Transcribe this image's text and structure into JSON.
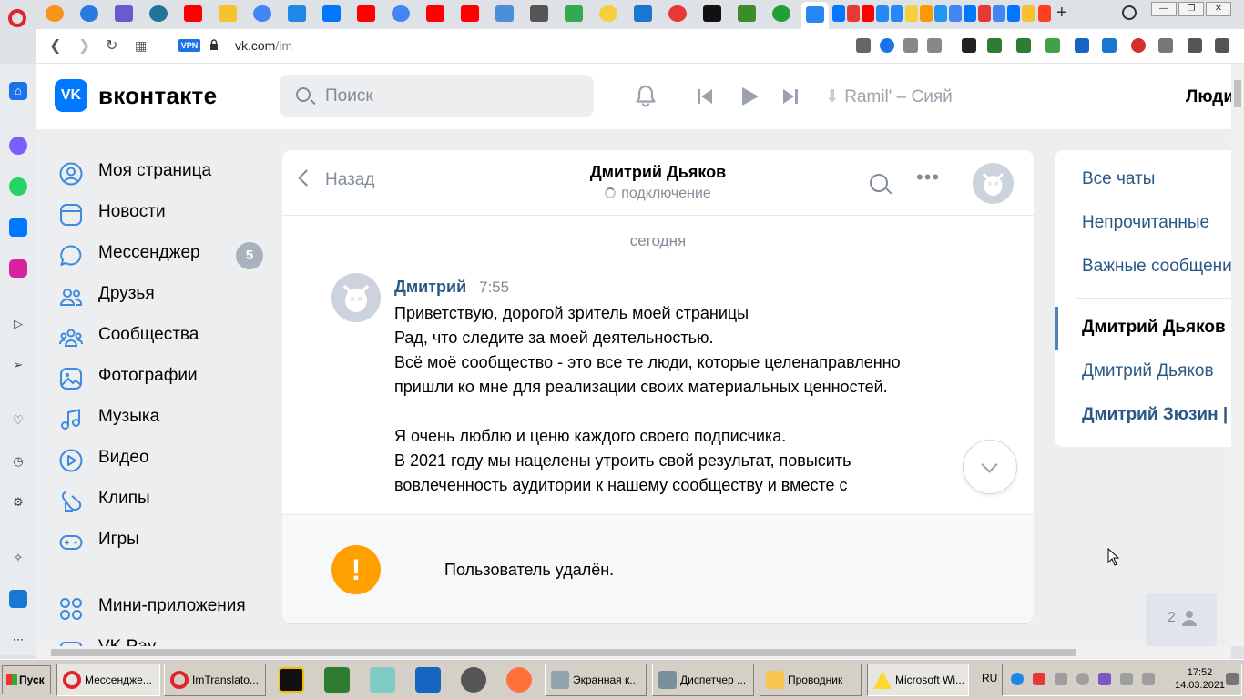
{
  "browser": {
    "url_host": "vk.com",
    "url_path": "/im",
    "vpn_label": "VPN",
    "newtab_glyph": "+",
    "window_buttons": [
      "—",
      "❐",
      "✕"
    ]
  },
  "vk": {
    "logo_mark": "VK",
    "logo_text": "вконтакте",
    "search_placeholder": "Поиск",
    "player_track": "Ramil' – Сияй",
    "people_link": "Люди",
    "menu": [
      {
        "label": "Моя страница"
      },
      {
        "label": "Новости"
      },
      {
        "label": "Мессенджер",
        "badge": "5"
      },
      {
        "label": "Друзья"
      },
      {
        "label": "Сообщества"
      },
      {
        "label": "Фотографии"
      },
      {
        "label": "Музыка"
      },
      {
        "label": "Видео"
      },
      {
        "label": "Клипы"
      },
      {
        "label": "Игры"
      },
      {
        "label": "Мини-приложения"
      },
      {
        "label": "VK Pay"
      }
    ],
    "chat": {
      "back_label": "Назад",
      "peer_name": "Дмитрий Дьяков",
      "peer_status": "подключение",
      "more_glyph": "•••",
      "day_label": "сегодня",
      "message": {
        "author": "Дмитрий",
        "time": "7:55",
        "lines": [
          "Приветствую, дорогой зритель моей страницы",
          "Рад, что следите за моей деятельностью.",
          "Всё моё сообщество - это все те люди, которые целенаправленно пришли ко мне для реализации своих материальных ценностей.",
          "",
          "Я очень люблю и ценю каждого своего подписчика.",
          "В 2021 году мы нацелены утроить свой результат, повысить вовлеченность аудитории к нашему сообществу и вместе с"
        ]
      },
      "warning_glyph": "!",
      "composer_notice": "Пользователь удалён."
    },
    "filters": {
      "items": [
        "Все чаты",
        "Непрочитанные",
        "Важные сообщения"
      ],
      "chats": [
        "Дмитрий Дьяков",
        "Дмитрий Дьяков",
        "Дмитрий Зюзин |"
      ]
    },
    "people_count": "2"
  },
  "taskbar": {
    "start_label": "Пуск",
    "windows": [
      "Мессендже...",
      "ImTranslato...",
      "Экранная к...",
      "Диспетчер ...",
      "Проводник",
      "Microsoft Wi..."
    ],
    "lang": "RU",
    "time": "17:52",
    "date": "14.03.2021"
  },
  "colors": {
    "vk_blue": "#0077ff",
    "link_blue": "#2a5885",
    "muted": "#818c99",
    "warning": "#ffa000",
    "badge": "#a8b1bd"
  }
}
